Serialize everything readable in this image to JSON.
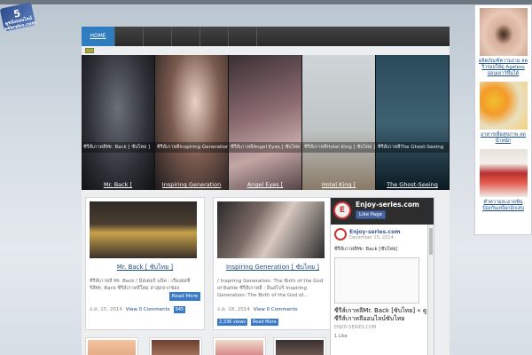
{
  "site_badge": {
    "line1": "5",
    "line2": "ดูหนังออนไลน์",
    "line3": "a4brahn.com"
  },
  "nav": {
    "items": [
      "HOME",
      "",
      "",
      "",
      "",
      ""
    ]
  },
  "slider": {
    "slides": [
      {
        "caption": "ซีรีส์เกาหลีMr. Back [ ซับไทย ]",
        "label": "Mr. Back ["
      },
      {
        "caption": "ซีรีส์เกาหลีInspiring Generation [ ซับไทย ]",
        "label": "Inspiring Generation"
      },
      {
        "caption": "ซีรีส์เกาหลีAngel Eyes [ ซับไทย ]",
        "label": "Angel Eyes ["
      },
      {
        "caption": "ซีรีส์เกาหลีHotel King [ ซับไทย ]",
        "label": "Hotel King ["
      },
      {
        "caption": "ซีรีส์เกาหลีThe Ghost-Seeing",
        "label": "The Ghost-Seeing"
      }
    ]
  },
  "posts": [
    {
      "title": "Mr. Back [ ซับไทย ]",
      "excerpt": "ซีรีส์เกาหลี Mr. Back / มิสเตอร์ แบ็ค : เรื่องย่อซีรีส์Mr. Back ซีรีส์เกาหลีใหม่ ล่าสุดจากช่อง",
      "date": "ธ.ค. 15, 2014",
      "comments": "View 0 Comments",
      "views": "945",
      "read_more": "Read More"
    },
    {
      "title": "Inspiring Generation [ ซับไทย ]",
      "excerpt": "/ Inspiring Generation: The Birth of the God of Battle ซีรีส์เกาหลี : อินสไปร์ Inspiring Generation: The Birth of the God of...",
      "date": "ธ.ค. 18, 2014",
      "comments": "View 0 Comments",
      "views": "2,336 views",
      "read_more": "Read More"
    }
  ],
  "fb_widget": {
    "page_name": "Enjoy-series.com",
    "like_label": "Like Page",
    "post_author": "Enjoy-series.com",
    "post_date": "December 15, 2014",
    "post_text": "ซีรีส์เกาหลีMr. Back [ซับไทย]",
    "link_title": "ซีรีส์เกาหลีMr. Back [ซับไทย] « ดูซีรีส์เกาหลีออนไลน์ซับไทย",
    "link_domain": "ENJOY-SERIES.COM",
    "likes": "1 Like"
  },
  "sidebar": {
    "items": [
      {
        "caption": "ผลิตภัณฑ์ความงาม ลดริ้วรอยให้ดู Ageless อ่อนเยาว์ขึ้นได้"
      },
      {
        "caption": "อาหารเพื่อสุขภาพ ลดน้ำหนัก"
      },
      {
        "caption": "ทำความสะอาดฟัน ป้องกันเหงือกอักเสบ"
      }
    ]
  },
  "colors": {
    "nav_active": "#2f7dbf",
    "link": "#1a4d8a",
    "button": "#3a7bc8",
    "facebook": "#4a66a0"
  }
}
